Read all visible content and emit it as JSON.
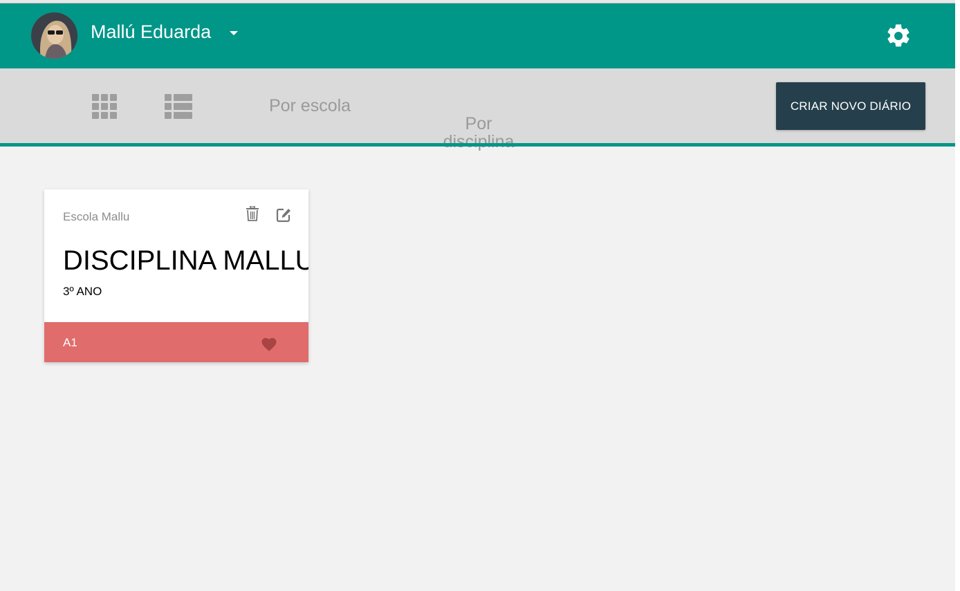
{
  "header": {
    "user_name": "Mallú Eduarda",
    "bg_color": "#009688"
  },
  "toolbar": {
    "filters": [
      {
        "label": "Por escola"
      },
      {
        "label": "Por\ndisciplina"
      }
    ],
    "create_button_label": "CRIAR NOVO DIÁRIO",
    "create_button_color": "#253f4c"
  },
  "cards": [
    {
      "school": "Escola Mallu",
      "subject": "DISCIPLINA MALLU",
      "grade": "3º ANO",
      "class_name": "A1",
      "footer_color": "#e06c6b"
    }
  ]
}
